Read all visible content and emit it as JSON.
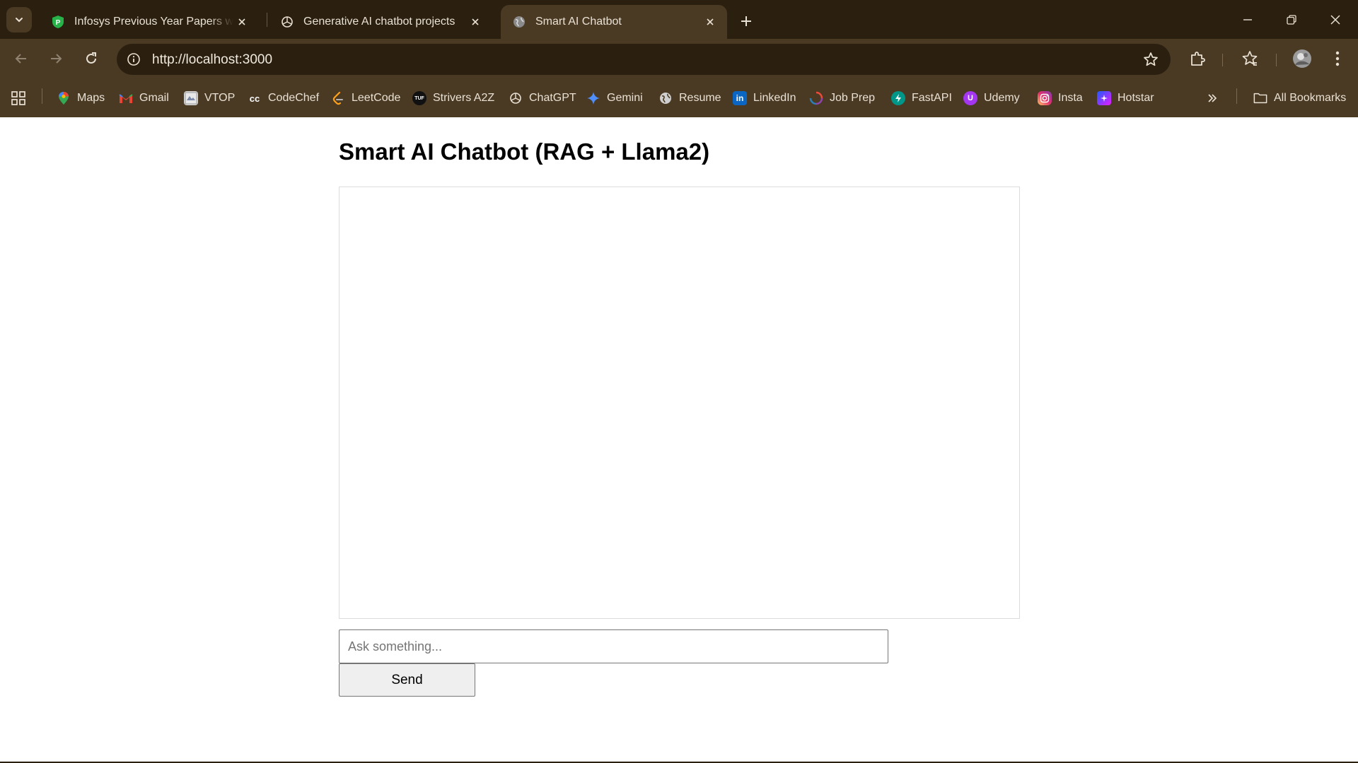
{
  "browser": {
    "tabs": [
      {
        "title": "Infosys Previous Year Papers with Solutions",
        "favicon": "green-shield-p-icon",
        "active": false
      },
      {
        "title": "Generative AI chatbot projects",
        "favicon": "chatgpt-logo-icon",
        "active": false
      },
      {
        "title": "Smart AI Chatbot",
        "favicon": "globe-icon",
        "active": true
      }
    ],
    "url": "http://localhost:3000",
    "bookmarks": [
      {
        "label": "Maps",
        "icon": "maps-pin-icon",
        "color": "#34a853"
      },
      {
        "label": "Gmail",
        "icon": "gmail-icon",
        "color": "#ea4335"
      },
      {
        "label": "VTOP",
        "icon": "vtop-icon",
        "color": "#c8c8c8"
      },
      {
        "label": "CodeChef",
        "icon": "codechef-icon",
        "color": "#ffffff"
      },
      {
        "label": "LeetCode",
        "icon": "leetcode-icon",
        "color": "#ffa116"
      },
      {
        "label": "Strivers A2Z",
        "icon": "tuf-icon",
        "color": "#111111"
      },
      {
        "label": "ChatGPT",
        "icon": "chatgpt-logo-icon",
        "color": "#e9e1d4"
      },
      {
        "label": "Gemini",
        "icon": "gemini-sparkle-icon",
        "color": "#4f8df9"
      },
      {
        "label": "Resume",
        "icon": "globe-icon",
        "color": "#cfcfcf"
      },
      {
        "label": "LinkedIn",
        "icon": "linkedin-icon",
        "color": "#0a66c2"
      },
      {
        "label": "Job Prep",
        "icon": "job-prep-icon",
        "color": "#c0392b"
      },
      {
        "label": "FastAPI",
        "icon": "fastapi-icon",
        "color": "#009688"
      },
      {
        "label": "Udemy",
        "icon": "udemy-icon",
        "color": "#a435f0"
      },
      {
        "label": "Insta",
        "icon": "instagram-icon",
        "color": "#e1306c"
      },
      {
        "label": "Hotstar",
        "icon": "hotstar-icon",
        "color": "#7b2ff7"
      }
    ],
    "all_bookmarks_label": "All Bookmarks"
  },
  "page": {
    "title": "Smart AI Chatbot (RAG + Llama2)",
    "input_placeholder": "Ask something...",
    "send_label": "Send"
  }
}
